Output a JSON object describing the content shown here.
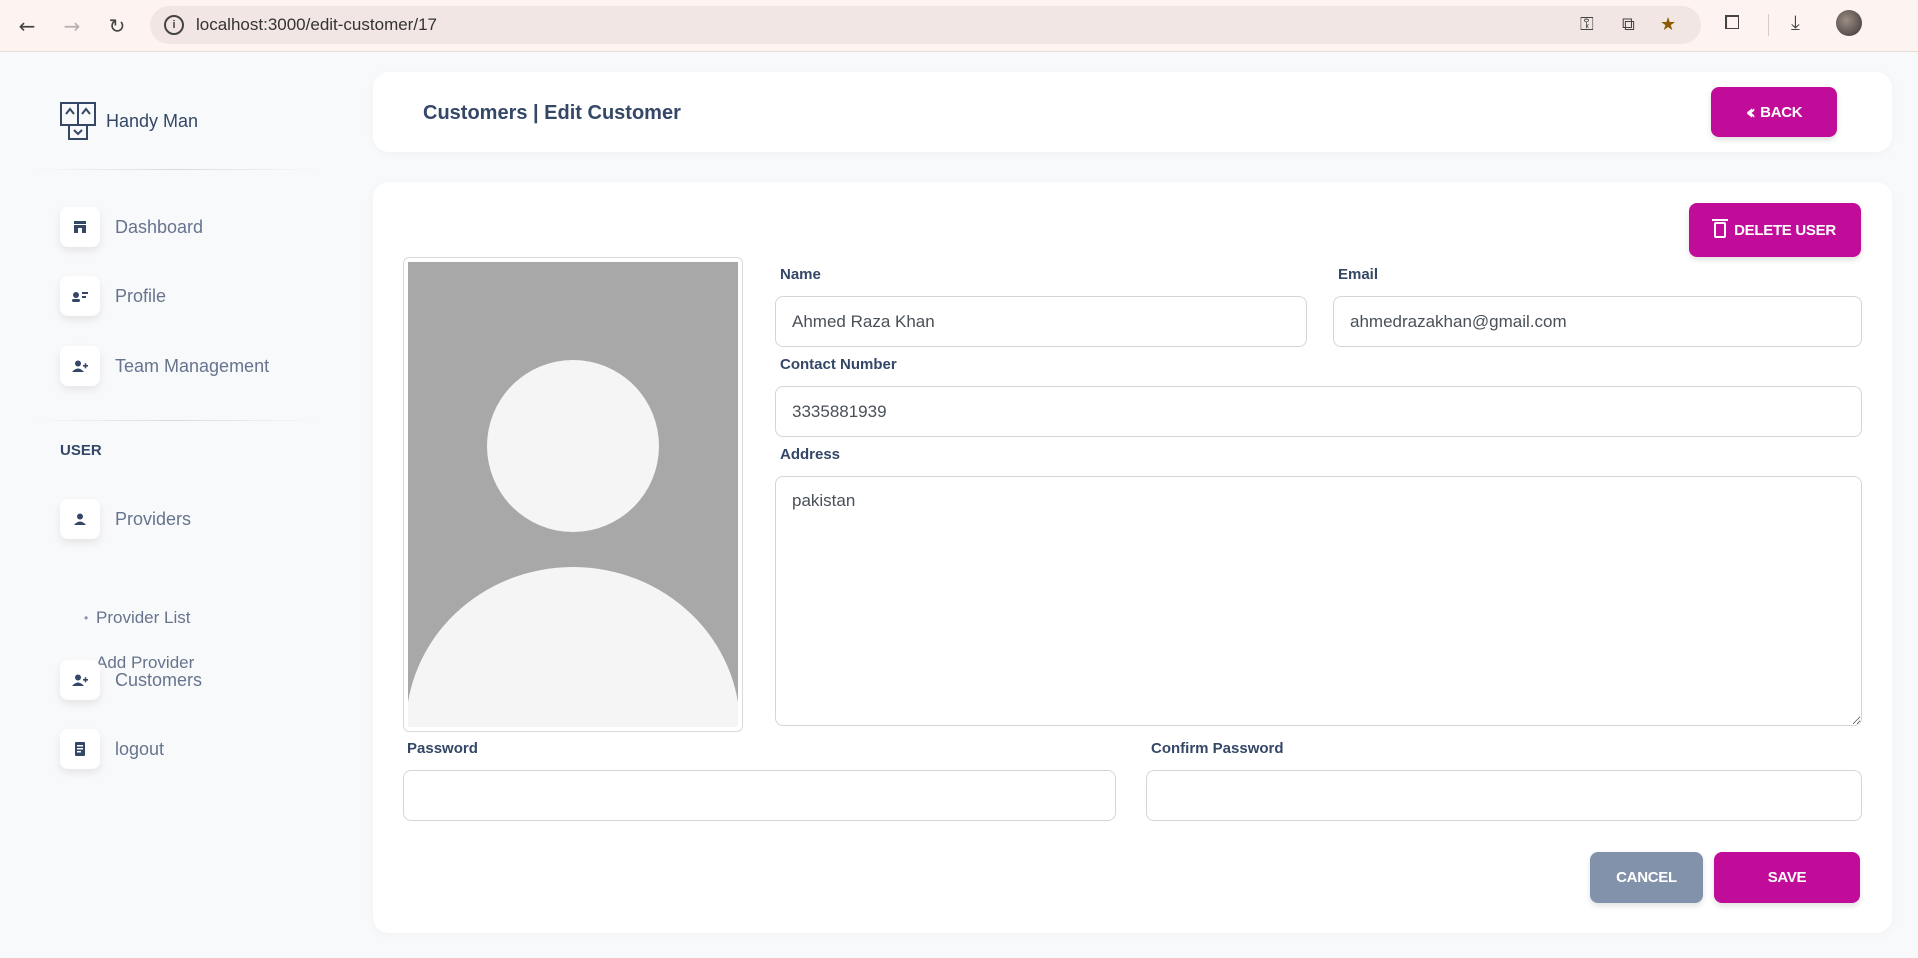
{
  "browser": {
    "url": "localhost:3000/edit-customer/17"
  },
  "sidebar": {
    "brand": "Handy Man",
    "nav": [
      {
        "label": "Dashboard",
        "icon": "shop-icon"
      },
      {
        "label": "Profile",
        "icon": "profile-card-icon"
      },
      {
        "label": "Team Management",
        "icon": "add-user-icon"
      }
    ],
    "section": "USER",
    "providers": {
      "label": "Providers",
      "icon": "user-icon"
    },
    "provider_sub": [
      "Provider List",
      "Add Provider"
    ],
    "customers": {
      "label": "Customers",
      "icon": "add-user-icon"
    },
    "logout": {
      "label": "logout",
      "icon": "document-icon"
    }
  },
  "header": {
    "title": "Customers | Edit Customer",
    "back_label": "BACK"
  },
  "form": {
    "delete_label": "DELETE USER",
    "name_label": "Name",
    "name_value": "Ahmed Raza Khan",
    "email_label": "Email",
    "email_value": "ahmedrazakhan@gmail.com",
    "contact_label": "Contact Number",
    "contact_value": "3335881939",
    "address_label": "Address",
    "address_value": "pakistan",
    "password_label": "Password",
    "password_value": "",
    "confirm_label": "Confirm Password",
    "confirm_value": "",
    "cancel_label": "CANCEL",
    "save_label": "SAVE"
  },
  "colors": {
    "accent": "#c10c99",
    "secondary": "#8392ab",
    "text": "#344767"
  }
}
